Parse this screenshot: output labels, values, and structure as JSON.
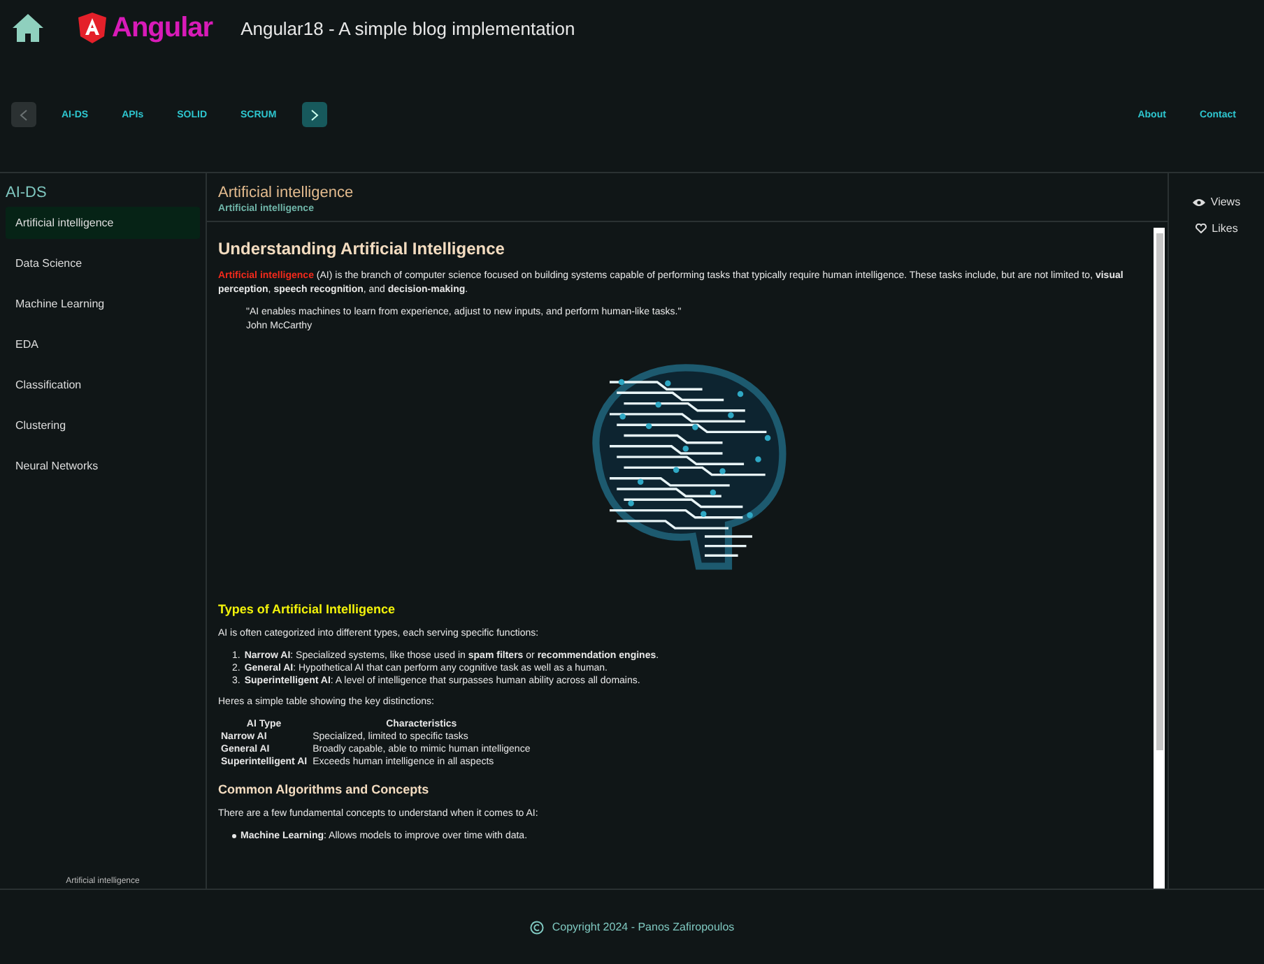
{
  "header": {
    "logo_text": "Angular",
    "title": "Angular18 - A simple blog implementation"
  },
  "nav": {
    "categories": [
      {
        "label": "AI-DS",
        "selected": false
      },
      {
        "label": "APIs",
        "selected": false
      },
      {
        "label": "SOLID",
        "selected": false
      },
      {
        "label": "SCRUM",
        "selected": false
      }
    ],
    "prev_disabled": true,
    "next_disabled": false,
    "links": [
      "About",
      "Contact"
    ]
  },
  "sidebar": {
    "title": "AI-DS",
    "items": [
      {
        "label": "Artificial intelligence",
        "selected": true
      },
      {
        "label": "Data Science",
        "selected": false
      },
      {
        "label": "Machine Learning",
        "selected": false
      },
      {
        "label": "EDA",
        "selected": false
      },
      {
        "label": "Classification",
        "selected": false
      },
      {
        "label": "Clustering",
        "selected": false
      },
      {
        "label": "Neural Networks",
        "selected": false
      }
    ],
    "footer": "Artificial intelligence"
  },
  "article": {
    "title": "Artificial intelligence",
    "subtitle": "Artificial intelligence",
    "heading": "Understanding Artificial Intelligence",
    "intro_term": "Artificial intelligence",
    "intro": " (AI) is the branch of computer science focused on building systems capable of performing tasks that typically require human intelligence. These tasks include, but are not limited to, **visual perception**, **speech recognition**, and **decision-making**.",
    "quote": "\"AI enables machines to learn from experience, adjust to new inputs, and perform human-like tasks.\"",
    "quote_author": "John McCarthy",
    "section1": "Types of Artificial Intelligence",
    "section1_intro": "AI is often categorized into different types, each serving specific functions:",
    "types": [
      {
        "number": "1.",
        "text": "**Narrow AI**: Specialized systems, like those used in **spam filters** or **recommendation engines**."
      },
      {
        "number": "2.",
        "text": "**General AI**: Hypothetical AI that can perform any cognitive task as well as a human."
      },
      {
        "number": "3.",
        "text": "**Superintelligent AI**: A level of intelligence that surpasses human ability across all domains."
      }
    ],
    "table_intro": "Heres a simple table showing the key distinctions:",
    "table": {
      "columns": [
        "AI Type",
        "Characteristics"
      ],
      "rows": [
        [
          "Narrow AI",
          "Specialized, limited to specific tasks"
        ],
        [
          "General AI",
          "Broadly capable, able to mimic human intelligence"
        ],
        [
          "Superintelligent AI",
          "Exceeds human intelligence in all aspects"
        ]
      ]
    },
    "section2": "Common Algorithms and Concepts",
    "section2_intro": "There are a few fundamental concepts to understand when it comes to AI:",
    "concepts": [
      "**Machine Learning**: Allows models to improve over time with data."
    ]
  },
  "stats": [
    "Views",
    "Likes"
  ],
  "footer": "Copyright 2024 - Panos Zafiropoulos"
}
